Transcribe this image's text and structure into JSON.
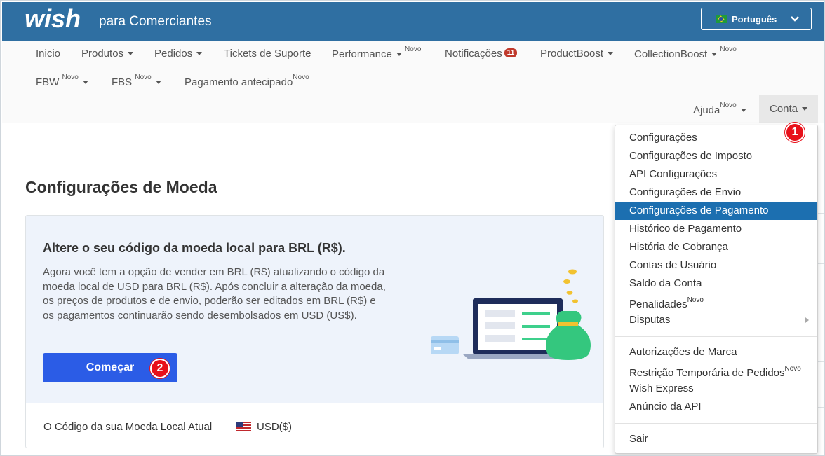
{
  "header": {
    "brand_sub": "para Comerciantes",
    "language": "Português"
  },
  "nav": {
    "row1": [
      {
        "label": "Inicio"
      },
      {
        "label": "Produtos"
      },
      {
        "label": "Pedidos"
      },
      {
        "label": "Tickets de Suporte"
      },
      {
        "label": "Performance",
        "tag": "Novo"
      },
      {
        "label": "Notificações",
        "badge": "11"
      },
      {
        "label": "ProductBoost"
      },
      {
        "label": "CollectionBoost",
        "tag": "Novo"
      }
    ],
    "row2": [
      {
        "label": "FBW",
        "tag": "Novo"
      },
      {
        "label": "FBS",
        "tag": "Novo"
      },
      {
        "label": "Pagamento antecipado",
        "tag": "Novo"
      }
    ],
    "help": {
      "label": "Ajuda",
      "tag": "Novo"
    },
    "account": {
      "label": "Conta"
    }
  },
  "page": {
    "title": "Configurações de Moeda"
  },
  "card": {
    "heading": "Altere o seu código da moeda local para BRL (R$).",
    "body": "Agora você tem a opção de vender em BRL (R$) atualizando o código da moeda local de USD para BRL (R$). Após concluir a alteração da moeda, os preços de produtos e de envio, poderão ser editados em BRL (R$) e os pagamentos continuarão sendo desembolsados em USD (US$).",
    "button": "Começar",
    "current_label": "O Código da sua Moeda Local Atual",
    "current_value": "USD($)"
  },
  "dropdown": {
    "items": [
      {
        "label": "Configurações"
      },
      {
        "label": "Configurações de Imposto"
      },
      {
        "label": "API Configurações"
      },
      {
        "label": "Configurações de Envio"
      },
      {
        "label": "Configurações de Pagamento",
        "active": true
      },
      {
        "label": "Histórico de Pagamento"
      },
      {
        "label": "História de Cobrança"
      },
      {
        "label": "Contas de Usuário"
      },
      {
        "label": "Saldo da Conta"
      },
      {
        "label": "Penalidades",
        "tag": "Novo"
      },
      {
        "label": "Disputas",
        "submenu": true
      },
      {
        "label": "Autorizações de Marca"
      },
      {
        "label": "Restrição Temporária de Pedidos",
        "tag": "Novo"
      },
      {
        "label": "Wish Express"
      },
      {
        "label": "Anúncio da API"
      },
      {
        "label": "Sair"
      }
    ]
  },
  "markers": {
    "m1": "1",
    "m2": "2"
  },
  "colors": {
    "header": "#2f6fa2",
    "primary_button": "#2b5ce6",
    "active_item": "#1c6fb0",
    "marker": "#e8101a"
  }
}
